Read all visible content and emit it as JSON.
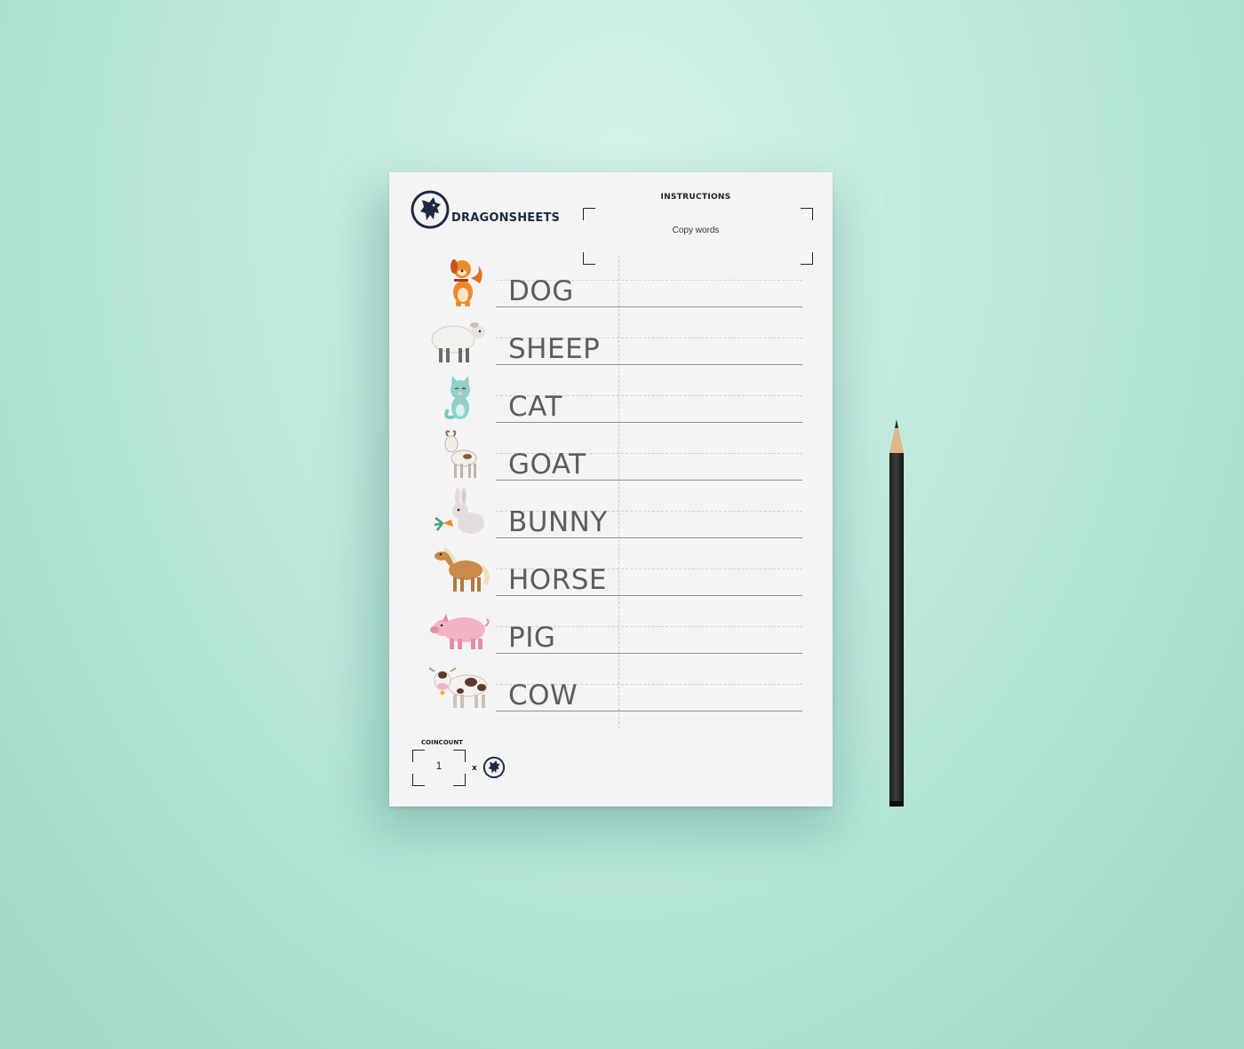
{
  "brand": {
    "name": "DRAGONSHEETS"
  },
  "instructions": {
    "title": "INSTRUCTIONS",
    "text": "Copy words"
  },
  "words": [
    {
      "word": "DOG",
      "icon": "dog-icon"
    },
    {
      "word": "SHEEP",
      "icon": "sheep-icon"
    },
    {
      "word": "CAT",
      "icon": "cat-icon"
    },
    {
      "word": "GOAT",
      "icon": "goat-icon"
    },
    {
      "word": "BUNNY",
      "icon": "bunny-icon"
    },
    {
      "word": "HORSE",
      "icon": "horse-icon"
    },
    {
      "word": "PIG",
      "icon": "pig-icon"
    },
    {
      "word": "COW",
      "icon": "cow-icon"
    }
  ],
  "coincount": {
    "label": "COINCOUNT",
    "value": "1",
    "multiplier": "x"
  },
  "colors": {
    "background": "#b7e6d8",
    "paper": "#f4f4f4",
    "brand": "#1d2a44",
    "text": "#5d5d5d"
  }
}
